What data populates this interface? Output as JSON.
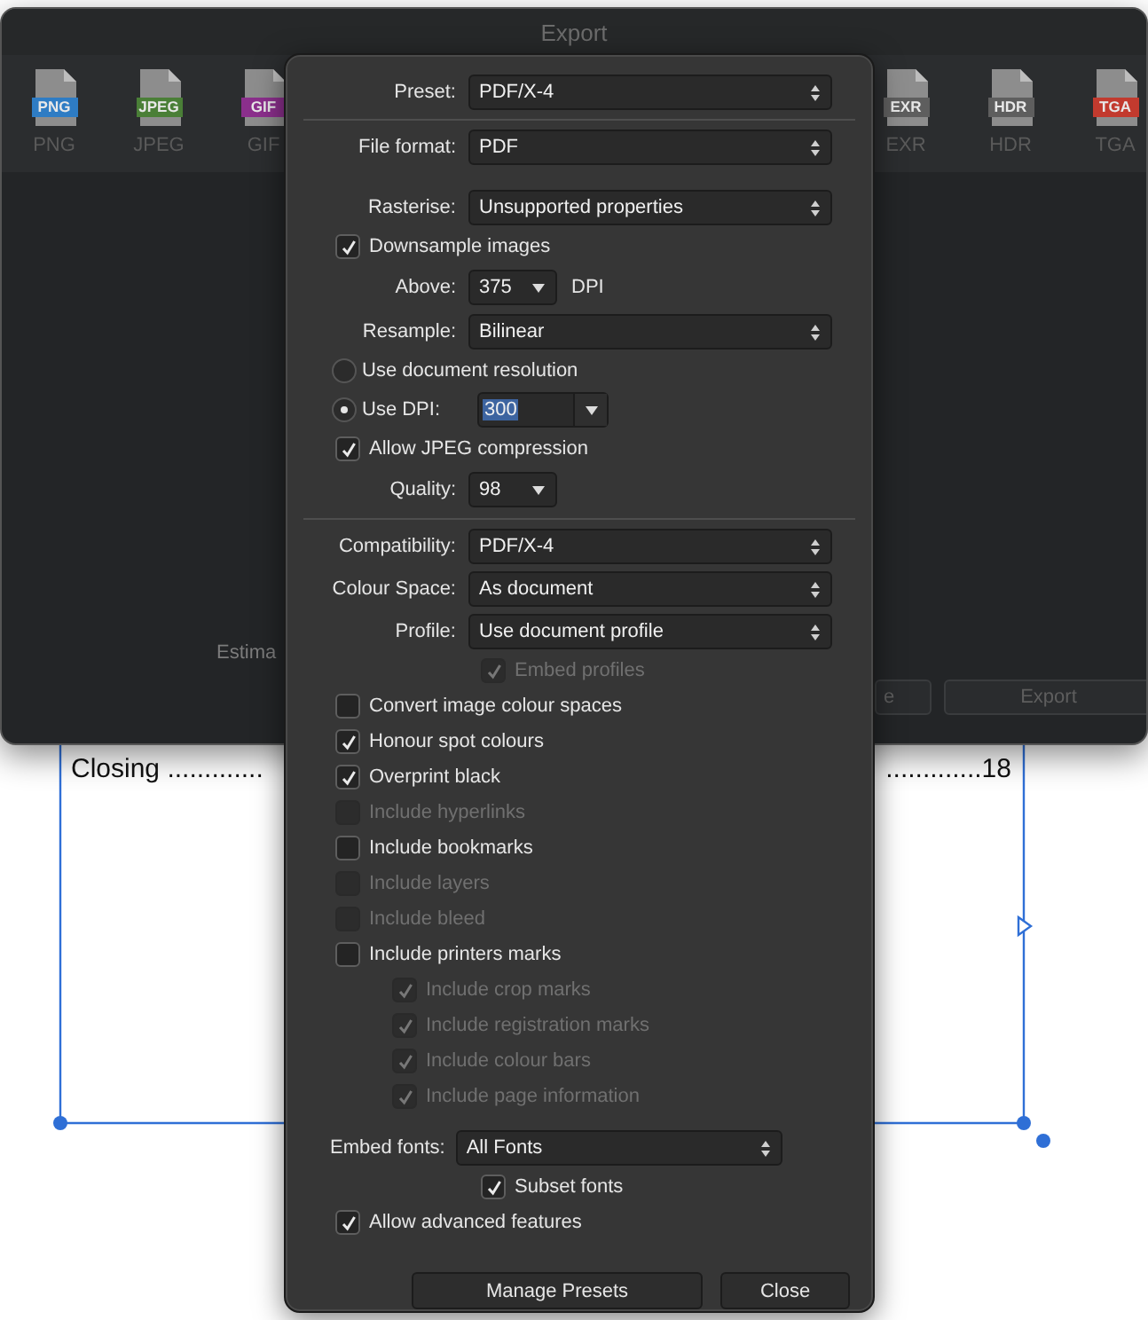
{
  "document": {
    "line_left": "Closing .............",
    "line_right": ".............18"
  },
  "export_window": {
    "title": "Export",
    "formats_left": [
      {
        "label": "PNG",
        "badge": "PNG",
        "color": "#2e7cc4"
      },
      {
        "label": "JPEG",
        "badge": "JPEG",
        "color": "#4a7f37"
      },
      {
        "label": "GIF",
        "badge": "GIF",
        "color": "#8b2f8c"
      }
    ],
    "formats_right": [
      {
        "label": "EXR",
        "badge": "EXR",
        "color": "#5e5e5e"
      },
      {
        "label": "HDR",
        "badge": "HDR",
        "color": "#5e5e5e"
      },
      {
        "label": "TGA",
        "badge": "TGA",
        "color": "#c23a2e"
      }
    ],
    "estimate_text": "Estima",
    "buttons": [
      {
        "label": "e"
      },
      {
        "label": "Export"
      }
    ]
  },
  "pdf_options": {
    "sections": [
      {
        "divider": true,
        "rows": [
          {
            "kind": "select",
            "label": "Preset:",
            "value": "PDF/X-4"
          }
        ]
      },
      {
        "divider": false,
        "rows": [
          {
            "kind": "select",
            "label": "File format:",
            "value": "PDF"
          }
        ]
      },
      {
        "divider": true,
        "rows": [
          {
            "kind": "select",
            "label": "Rasterise:",
            "value": "Unsupported properties"
          },
          {
            "kind": "checkbox",
            "label": "Downsample images",
            "checked": true,
            "disabled": false
          },
          {
            "kind": "combo",
            "label": "Above:",
            "value": "375",
            "suffix": "DPI"
          },
          {
            "kind": "select",
            "label": "Resample:",
            "value": "Bilinear"
          },
          {
            "kind": "radio",
            "label": "Use document resolution",
            "selected": false
          },
          {
            "kind": "radio",
            "label": "Use DPI:",
            "selected": true,
            "value": "300",
            "text_selected": true
          },
          {
            "kind": "checkbox",
            "label": "Allow JPEG compression",
            "checked": true,
            "disabled": false
          },
          {
            "kind": "combo",
            "label": "Quality:",
            "value": "98"
          }
        ]
      },
      {
        "divider": false,
        "rows": [
          {
            "kind": "select",
            "label": "Compatibility:",
            "value": "PDF/X-4"
          },
          {
            "kind": "select",
            "label": "Colour Space:",
            "value": "As document"
          },
          {
            "kind": "select",
            "label": "Profile:",
            "value": "Use document profile"
          },
          {
            "kind": "field_checkbox",
            "label": "Embed profiles",
            "checked": true,
            "disabled": true
          },
          {
            "kind": "checkbox",
            "label": "Convert image colour spaces",
            "checked": false,
            "disabled": false
          },
          {
            "kind": "checkbox",
            "label": "Honour spot colours",
            "checked": true,
            "disabled": false
          },
          {
            "kind": "checkbox",
            "label": "Overprint black",
            "checked": true,
            "disabled": false
          },
          {
            "kind": "checkbox",
            "label": "Include hyperlinks",
            "checked": false,
            "disabled": true
          },
          {
            "kind": "checkbox",
            "label": "Include bookmarks",
            "checked": false,
            "disabled": false
          },
          {
            "kind": "checkbox",
            "label": "Include layers",
            "checked": false,
            "disabled": true
          },
          {
            "kind": "checkbox",
            "label": "Include bleed",
            "checked": false,
            "disabled": true
          },
          {
            "kind": "checkbox",
            "label": "Include printers marks",
            "checked": false,
            "disabled": false,
            "children": [
              {
                "kind": "checkbox",
                "label": "Include crop marks",
                "checked": true,
                "disabled": true
              },
              {
                "kind": "checkbox",
                "label": "Include registration marks",
                "checked": true,
                "disabled": true
              },
              {
                "kind": "checkbox",
                "label": "Include colour bars",
                "checked": true,
                "disabled": true
              },
              {
                "kind": "checkbox",
                "label": "Include page information",
                "checked": true,
                "disabled": true
              }
            ]
          },
          {
            "kind": "font_select",
            "label": "Embed fonts:",
            "value": "All Fonts"
          },
          {
            "kind": "field_checkbox",
            "label": "Subset fonts",
            "checked": true,
            "disabled": false
          },
          {
            "kind": "checkbox",
            "label": "Allow advanced features",
            "checked": true,
            "disabled": false
          }
        ]
      }
    ],
    "buttons": [
      {
        "label": "Manage Presets"
      },
      {
        "label": "Close"
      }
    ]
  }
}
